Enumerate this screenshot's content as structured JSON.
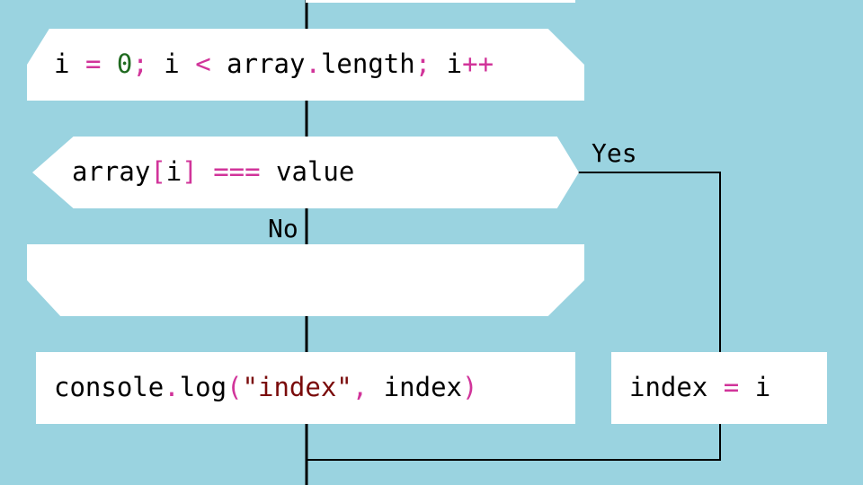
{
  "nodes": {
    "loop": {
      "i1": "i",
      "eq": "=",
      "zero": "0",
      "semi1": ";",
      "i2": "i",
      "lt": "<",
      "array": "array",
      "dot": ".",
      "length": "length",
      "semi2": ";",
      "i3": "i",
      "inc": "++"
    },
    "condition": {
      "array": "array",
      "lbr": "[",
      "i": "i",
      "rbr": "]",
      "op": "===",
      "value": "value"
    },
    "log": {
      "console": "console",
      "dot": ".",
      "log": "log",
      "lp": "(",
      "str": "\"index\"",
      "comma": ",",
      "arg": "index",
      "rp": ")"
    },
    "assign": {
      "index": "index",
      "eq": "=",
      "i": "i"
    }
  },
  "labels": {
    "yes": "Yes",
    "no": "No"
  },
  "colors": {
    "background": "#9ad3e0",
    "node_fill": "#ffffff",
    "line": "#000000",
    "operator": "#d1349a",
    "number": "#1f6a1f",
    "string": "#7a0b0b"
  }
}
